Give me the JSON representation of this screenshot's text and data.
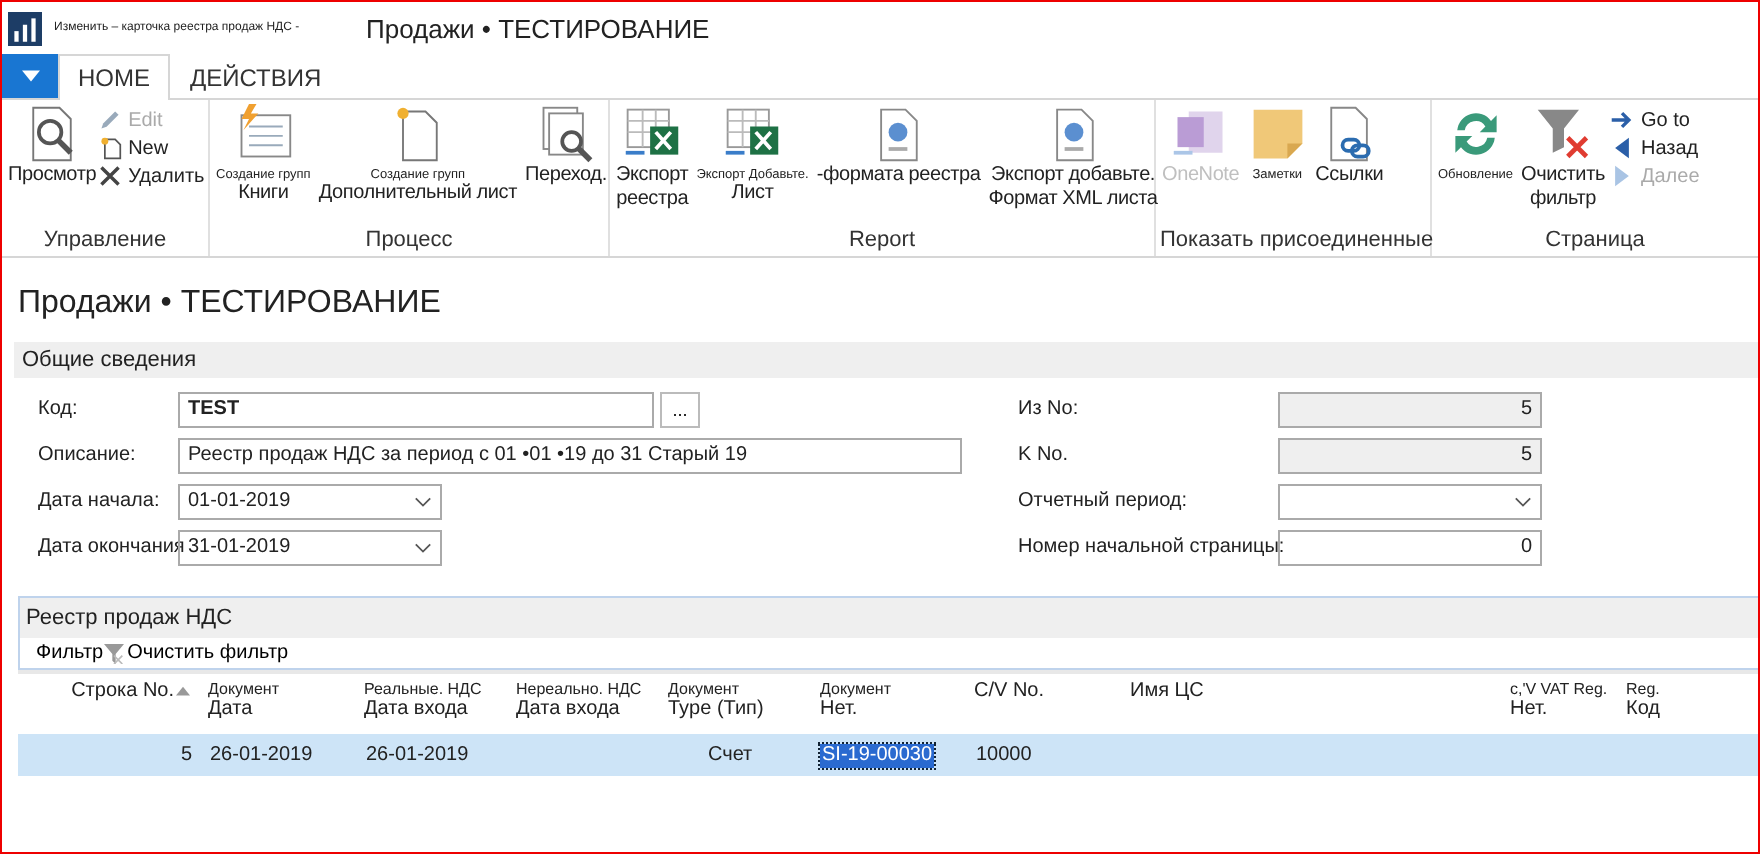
{
  "window": {
    "caption": "Изменить – карточка реестра продаж НДС -",
    "title": "Продажи • ТЕСТИРОВАНИЕ"
  },
  "ribbon": {
    "tabs": [
      {
        "label": "HOME",
        "selected": true
      },
      {
        "label": "ДЕЙСТВИЯ",
        "selected": false
      }
    ],
    "groups": [
      {
        "label": "Управление",
        "items": [
          {
            "kind": "large",
            "label": "Просмотр",
            "disabled": false
          },
          {
            "kind": "small",
            "label": "Edit",
            "disabled": true
          },
          {
            "kind": "small",
            "label": "New",
            "disabled": false
          },
          {
            "kind": "small",
            "label": "Удалить",
            "disabled": false
          }
        ]
      },
      {
        "label": "Процесс",
        "items": [
          {
            "kind": "large",
            "caption": "Создание групп",
            "label": "Книги",
            "disabled": false
          },
          {
            "kind": "large",
            "caption": "Создание групп",
            "label": "Дополнительный лист",
            "disabled": false
          },
          {
            "kind": "large",
            "label": "Переход.",
            "disabled": false
          }
        ]
      },
      {
        "label": "Report",
        "items": [
          {
            "kind": "large",
            "label": "Экспорт\nреестра",
            "disabled": false
          },
          {
            "kind": "large",
            "caption": "Экспорт Добавьте.",
            "label": "Лист",
            "disabled": false
          },
          {
            "kind": "large",
            "label": "-формата реестра",
            "disabled": false
          },
          {
            "kind": "large",
            "label": "Экспорт добавьте.\nФормат XML листа",
            "disabled": false
          }
        ]
      },
      {
        "label": "Показать присоединенные",
        "items": [
          {
            "kind": "large",
            "label": "OneNote",
            "disabled": true
          },
          {
            "kind": "large",
            "caption": "Заметки",
            "disabled": false
          },
          {
            "kind": "large",
            "label": "Ссылки",
            "disabled": false
          }
        ]
      },
      {
        "label": "Страница",
        "items": [
          {
            "kind": "large",
            "caption": "Обновление",
            "disabled": false
          },
          {
            "kind": "large",
            "label": "Очистить\nфильтр",
            "disabled": false
          },
          {
            "kind": "small",
            "label": "Go to",
            "disabled": false
          },
          {
            "kind": "small",
            "label": "Назад",
            "disabled": false
          },
          {
            "kind": "small",
            "label": "Далее",
            "disabled": true
          }
        ]
      }
    ]
  },
  "page_title": "Продажи • ТЕСТИРОВАНИЕ",
  "general": {
    "title": "Общие сведения",
    "left": [
      {
        "kind": "text",
        "label": "Код:",
        "value": "TEST",
        "lookup": "..."
      },
      {
        "kind": "text",
        "label": "Описание:",
        "value": "Реестр продаж НДС за период с 01 •01 •19 до 31 Старый 19"
      },
      {
        "kind": "select",
        "label": "Дата начала:",
        "value": "01-01-2019"
      },
      {
        "kind": "select",
        "label": "Дата окончания",
        "value": "31-01-2019"
      }
    ],
    "right": [
      {
        "kind": "number",
        "label": "Из No:",
        "value": "5",
        "disabled": true
      },
      {
        "kind": "number",
        "label": "K No.",
        "value": "5",
        "disabled": true
      },
      {
        "kind": "select",
        "label": "Отчетный период:",
        "disabled": false
      },
      {
        "kind": "number",
        "label": "Номер начальной страницы:",
        "value": "0",
        "disabled": false
      }
    ]
  },
  "lines": {
    "title": "Реестр продаж НДС",
    "actions": [
      "Фильтр",
      "Очистить фильтр"
    ],
    "columns": [
      {
        "top": "Строка No.",
        "sorted": true
      },
      {
        "top": "Документ",
        "bottom": "Дата",
        "sorted": false
      },
      {
        "top": "Реальные. НДС",
        "bottom": "Дата входа",
        "sorted": false
      },
      {
        "top": "Нереально. НДС",
        "bottom": "Дата входа",
        "sorted": false
      },
      {
        "top": "Документ",
        "bottom": "Type (Тип)",
        "sorted": false
      },
      {
        "top": "Документ",
        "bottom": "Нет.",
        "sorted": false
      },
      {
        "top": "C/V No.",
        "sorted": false
      },
      {
        "top": "Имя ЦС",
        "sorted": false
      },
      {
        "top": "c,'V VAT Reg.",
        "bottom": "Нет.",
        "sorted": false
      },
      {
        "top": "Reg.",
        "bottom": "Код",
        "sorted": false
      }
    ],
    "rows": [
      {
        "selected": true,
        "cells": [
          {
            "text": "5",
            "selected": false
          },
          {
            "text": "26-01-2019",
            "selected": false
          },
          {
            "text": "26-01-2019",
            "selected": false
          },
          {
            "selected": false
          },
          {
            "text": "Счет",
            "selected": false
          },
          {
            "text": "SI-19-00030",
            "selected": true
          },
          {
            "text": "10000",
            "selected": false
          },
          {
            "selected": false
          },
          {
            "selected": false
          },
          {
            "selected": false
          }
        ]
      }
    ]
  }
}
